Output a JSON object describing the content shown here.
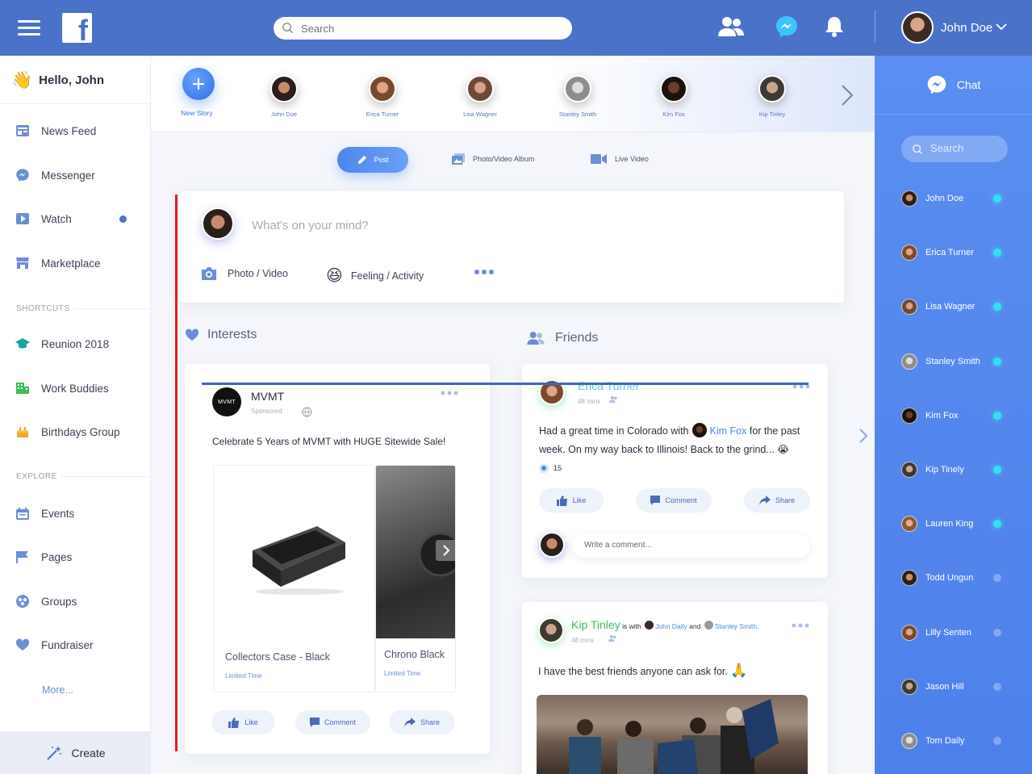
{
  "header": {
    "search_placeholder": "Search",
    "user_name": "John Doe",
    "icons": [
      "friends-icon",
      "messenger-icon",
      "bell-icon"
    ]
  },
  "sidebar": {
    "greeting": "Hello, John",
    "items": [
      {
        "label": "News Feed",
        "icon": "newsfeed-icon"
      },
      {
        "label": "Messenger",
        "icon": "messenger-icon"
      },
      {
        "label": "Watch",
        "icon": "watch-icon"
      },
      {
        "label": "Marketplace",
        "icon": "marketplace-icon"
      }
    ],
    "shortcuts_title": "SHORTCUTS",
    "shortcuts": [
      {
        "label": "Reunion 2018",
        "icon": "graduation-icon"
      },
      {
        "label": "Work Buddies",
        "icon": "building-icon"
      },
      {
        "label": "Birthdays Group",
        "icon": "cake-icon"
      }
    ],
    "explore_title": "EXPLORE",
    "explore": [
      {
        "label": "Events",
        "icon": "calendar-icon"
      },
      {
        "label": "Pages",
        "icon": "flag-icon"
      },
      {
        "label": "Groups",
        "icon": "groups-icon"
      },
      {
        "label": "Fundraiser",
        "icon": "heart-icon"
      }
    ],
    "more_label": "More...",
    "create_label": "Create"
  },
  "stories": {
    "new_story_label": "New Story",
    "people": [
      "John Doe",
      "Erica Turner",
      "Lisa Wagner",
      "Stanley Smith",
      "Kim Fox",
      "Kip Tinley"
    ]
  },
  "post_types": {
    "post": "Post",
    "album": "Photo/Video Album",
    "live": "Live Video"
  },
  "composer": {
    "placeholder": "What's on your mind?",
    "photo_label": "Photo / Video",
    "feeling_label": "Feeling / Activity"
  },
  "interests": {
    "title": "Interests",
    "ad": {
      "brand": "MVMT",
      "logo_text": "MVMT",
      "sponsored": "Sponsored",
      "text": "Celebrate 5 Years of MVMT with HUGE Sitewide Sale!",
      "products": [
        {
          "name": "Collectors Case - Black",
          "sub": "Limited Time"
        },
        {
          "name": "Chrono Black",
          "sub": "Limited Time"
        }
      ]
    }
  },
  "friends": {
    "title": "Friends",
    "post1": {
      "author": "Erica Turner",
      "time": "48 mins",
      "text_a": "Had a great time in Colorado with",
      "mention": "Kim Fox",
      "text_b": "for the past week. On my way back to Illinois! Back to the grind...",
      "emoji": "😭",
      "reactions": "15",
      "comment_placeholder": "Write a comment..."
    },
    "post2": {
      "author": "Kip Tinley",
      "with_text": "is with",
      "with_1": "John Daily",
      "and_text": "and",
      "with_2": "Stanley Smith.",
      "time": "48 mins",
      "text": "I have the best friends anyone can ask for.",
      "emoji": "🙏"
    }
  },
  "actions": {
    "like": "Like",
    "comment": "Comment",
    "share": "Share"
  },
  "chat": {
    "title": "Chat",
    "search_placeholder": "Search",
    "contacts": [
      {
        "name": "John Doe",
        "online": true
      },
      {
        "name": "Erica Turner",
        "online": true
      },
      {
        "name": "Lisa Wagner",
        "online": true
      },
      {
        "name": "Stanley Smith",
        "online": true
      },
      {
        "name": "Kim Fox",
        "online": true
      },
      {
        "name": "Kip Tinely",
        "online": true
      },
      {
        "name": "Lauren King",
        "online": true
      },
      {
        "name": "Todd Ungun",
        "online": false
      },
      {
        "name": "Lilly Senten",
        "online": false
      },
      {
        "name": "Jason Hill",
        "online": false
      },
      {
        "name": "Tom Daily",
        "online": false
      }
    ]
  },
  "colors": {
    "brand": "#4a72c9",
    "accent": "#4f86ef",
    "online": "#34e0f0",
    "green_name": "#3cbf5a"
  }
}
